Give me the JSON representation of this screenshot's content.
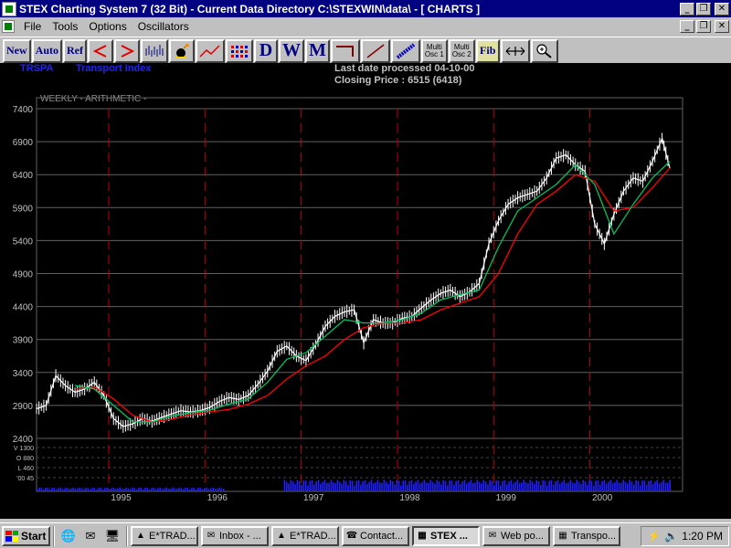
{
  "window": {
    "title": "STEX Charting System 7 (32 Bit)  - Current Data Directory C:\\STEXWIN\\data\\ - [  CHARTS   ]",
    "menus": [
      "File",
      "Tools",
      "Options",
      "Oscillators"
    ],
    "min_glyph": "_",
    "restore_glyph": "❐",
    "close_glyph": "✕"
  },
  "toolbar": {
    "new": "New",
    "auto": "Auto",
    "ref": "Ref",
    "d": "D",
    "w": "W",
    "m": "M",
    "multi1_line1": "Multi",
    "multi1_line2": "Osc 1",
    "multi2_line1": "Multi",
    "multi2_line2": "Osc 2",
    "fib": "Fib",
    "icons": [
      "arrow-left-icon",
      "arrow-right-icon",
      "bar-chart-icon",
      "bomb-icon",
      "line-chart-icon",
      "grid-icon",
      "bracket-icon",
      "trendline-icon",
      "hatched-line-icon",
      "zoom-width-icon",
      "zoom-icon"
    ]
  },
  "chart_header": {
    "symbol": "TRSPA",
    "name": "Transport Index",
    "last_date": "Last date processed 04-10-00",
    "closing": "Closing Price : 6515  (6418)",
    "mode": "WEEKLY - ARITHMETIC -"
  },
  "chart_data": {
    "type": "line",
    "title": "",
    "y_ticks": [
      2400,
      2900,
      3400,
      3900,
      4400,
      4900,
      5400,
      5900,
      6400,
      6900,
      7400
    ],
    "ylim": [
      2400,
      7400
    ],
    "x_ticks": [
      "1995",
      "1996",
      "1997",
      "1998",
      "1999",
      "2000"
    ],
    "x_tick_years": [
      1995,
      1996,
      1997,
      1998,
      1999,
      2000
    ],
    "x_range": [
      1994.15,
      2000.73
    ],
    "grid": true,
    "vertical_year_lines": true,
    "series": [
      {
        "color": "#ffffff",
        "x": [
          1994.15,
          1994.25,
          1994.35,
          1994.45,
          1994.55,
          1994.65,
          1994.75,
          1994.85,
          1994.95,
          1995.05,
          1995.15,
          1995.25,
          1995.35,
          1995.45,
          1995.55,
          1995.65,
          1995.75,
          1995.85,
          1995.95,
          1996.05,
          1996.15,
          1996.25,
          1996.35,
          1996.45,
          1996.55,
          1996.65,
          1996.75,
          1996.85,
          1996.95,
          1997.05,
          1997.15,
          1997.25,
          1997.35,
          1997.45,
          1997.55,
          1997.65,
          1997.75,
          1997.85,
          1997.95,
          1998.05,
          1998.15,
          1998.25,
          1998.35,
          1998.45,
          1998.55,
          1998.65,
          1998.75,
          1998.85,
          1998.95,
          1999.05,
          1999.15,
          1999.25,
          1999.35,
          1999.45,
          1999.55,
          1999.65,
          1999.75,
          1999.85,
          1999.95,
          2000.05,
          2000.15,
          2000.25,
          2000.35,
          2000.45,
          2000.55,
          2000.65,
          2000.73
        ],
        "y": [
          2850,
          2900,
          3350,
          3200,
          3100,
          3150,
          3250,
          3050,
          2700,
          2580,
          2620,
          2700,
          2660,
          2720,
          2770,
          2820,
          2800,
          2820,
          2870,
          2960,
          3020,
          2990,
          3050,
          3220,
          3420,
          3720,
          3800,
          3650,
          3580,
          3820,
          4100,
          4250,
          4320,
          4350,
          3850,
          4200,
          4150,
          4150,
          4220,
          4250,
          4380,
          4500,
          4600,
          4650,
          4550,
          4620,
          4750,
          5350,
          5700,
          5950,
          6050,
          6100,
          6150,
          6350,
          6650,
          6700,
          6550,
          6450,
          5650,
          5350,
          5800,
          6150,
          6350,
          6300,
          6600,
          6950,
          6500
        ]
      },
      {
        "color": "#ff0000",
        "x": [
          1994.55,
          1994.75,
          1994.95,
          1995.15,
          1995.35,
          1995.55,
          1995.75,
          1995.95,
          1996.15,
          1996.35,
          1996.55,
          1996.75,
          1996.95,
          1997.15,
          1997.35,
          1997.55,
          1997.75,
          1997.95,
          1998.15,
          1998.35,
          1998.55,
          1998.75,
          1998.95,
          1999.15,
          1999.35,
          1999.55,
          1999.75,
          1999.95,
          2000.15,
          2000.35,
          2000.55,
          2000.73
        ],
        "y": [
          3150,
          3180,
          3000,
          2750,
          2650,
          2690,
          2760,
          2800,
          2840,
          2920,
          3050,
          3300,
          3500,
          3650,
          3900,
          4080,
          4150,
          4150,
          4200,
          4350,
          4450,
          4550,
          4900,
          5500,
          5950,
          6150,
          6400,
          6300,
          5850,
          5900,
          6200,
          6500
        ]
      },
      {
        "color": "#00c060",
        "x": [
          1994.55,
          1994.75,
          1994.95,
          1995.15,
          1995.35,
          1995.55,
          1995.75,
          1995.95,
          1996.15,
          1996.35,
          1996.55,
          1996.75,
          1996.95,
          1997.15,
          1997.35,
          1997.55,
          1997.75,
          1997.95,
          1998.15,
          1998.35,
          1998.55,
          1998.75,
          1998.95,
          1999.15,
          1999.35,
          1999.55,
          1999.75,
          1999.95,
          2000.15,
          2000.35,
          2000.55,
          2000.73
        ],
        "y": [
          3200,
          3150,
          2900,
          2650,
          2650,
          2740,
          2790,
          2830,
          2920,
          3000,
          3250,
          3600,
          3700,
          3950,
          4200,
          4150,
          4150,
          4200,
          4300,
          4500,
          4580,
          4650,
          5300,
          5850,
          6050,
          6250,
          6550,
          6250,
          5500,
          5950,
          6350,
          6600
        ]
      }
    ],
    "oscillator_labels": [
      "V 1300",
      "O 880",
      "L 460",
      "'00 45"
    ],
    "volume": [
      {
        "x_start": 1994.15,
        "x_end": 1996.1,
        "level": 0.15
      },
      {
        "x_start": 1996.72,
        "x_end": 2000.73,
        "level": 0.45
      }
    ]
  },
  "taskbar": {
    "start": "Start",
    "tasks": [
      "E*TRAD...",
      "Inbox - ...",
      "E*TRAD...",
      "Contact...",
      "STEX ...",
      "Web po...",
      "Transpo..."
    ],
    "active_index": 4,
    "clock": "1:20 PM"
  }
}
